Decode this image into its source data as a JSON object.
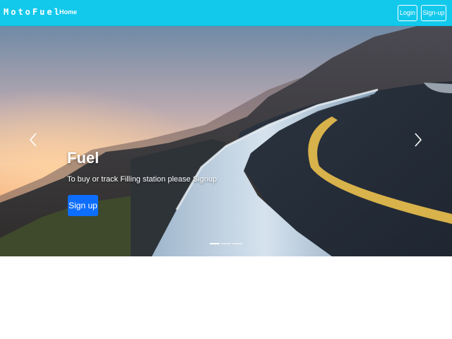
{
  "navbar": {
    "brand": "MotoFuel",
    "home_link": "Home",
    "login_button": "Login",
    "signup_button": "Sign-up",
    "background_color": "#12c9ec"
  },
  "carousel": {
    "prev_icon": "chevron-left-icon",
    "next_icon": "chevron-right-icon",
    "caption": {
      "title": "Fuel",
      "text": "To buy or track Filling station please Signup",
      "button": "Sign up"
    },
    "active_slide": 1,
    "slide_count": 3,
    "button_color": "#0d6efd"
  }
}
